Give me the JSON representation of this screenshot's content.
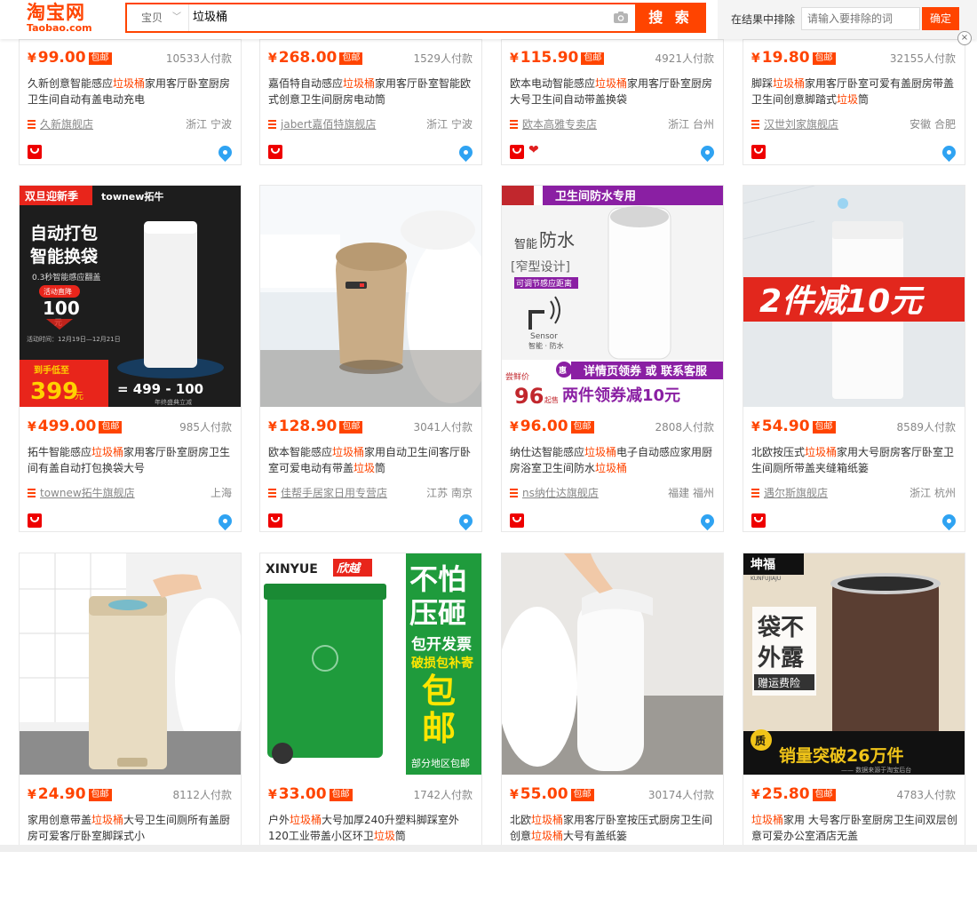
{
  "header": {
    "logo_cn": "淘宝网",
    "logo_en": "Taobao.com",
    "scope": "宝贝",
    "query": "垃圾桶",
    "search_button": "搜 索",
    "exclude_label": "在结果中排除",
    "exclude_placeholder": "请输入要排除的词",
    "exclude_button": "确定",
    "close": "×"
  },
  "badge": "包邮",
  "currency": "¥",
  "row1": [
    {
      "price": "99.00",
      "sales": "10533人付款",
      "title_pre": "久新创意智能感应",
      "hl": "垃圾桶",
      "title_post": "家用客厅卧室厨房卫生间自动有盖电动充电",
      "shop": "久新旗舰店",
      "loc": "浙江 宁波"
    },
    {
      "price": "268.00",
      "sales": "1529人付款",
      "title_pre": "嘉佰特自动感应",
      "hl": "垃圾桶",
      "title_post": "家用客厅卧室智能欧式创意卫生间厨房电动筒",
      "shop": "jabert嘉佰特旗舰店",
      "loc": "浙江 宁波"
    },
    {
      "price": "115.90",
      "sales": "4921人付款",
      "title_pre": "欧本电动智能感应",
      "hl": "垃圾桶",
      "title_post": "家用客厅卧室厨房大号卫生间自动带盖换袋",
      "shop": "欧本高雅专卖店",
      "loc": "浙江 台州"
    },
    {
      "price": "19.80",
      "sales": "32155人付款",
      "title_pre": "脚踩",
      "hl": "垃圾桶",
      "title_post": "家用客厅卧室可爱有盖厨房带盖卫生间创意脚踏式",
      "title_tail": "垃圾",
      "title_end": "筒",
      "shop": "汉世刘家旗舰店",
      "loc": "安徽 合肥"
    }
  ],
  "row2": [
    {
      "price": "499.00",
      "sales": "985人付款",
      "title_pre": "拓牛智能感应",
      "hl": "垃圾桶",
      "title_post": "家用客厅卧室厨房卫生间有盖自动打包换袋大号",
      "shop": "townew拓牛旗舰店",
      "loc": "上海",
      "img": {
        "tag": "双旦迎新季",
        "brand": "townew拓牛",
        "line1": "自动打包",
        "line2": "智能换袋",
        "sub": "0.3秒智能感应翻盖",
        "act": "活动直降",
        "amount": "100",
        "unit": "元",
        "date": "活动时间：12月19日—12月21日",
        "sale": "到手低至",
        "final": "399",
        "final_unit": "元",
        "formula": "= 499 - 100",
        "formula_sub": "年终盛典立减"
      }
    },
    {
      "price": "128.90",
      "sales": "3041人付款",
      "title_pre": "欧本智能感应",
      "hl": "垃圾桶",
      "title_post": "家用自动卫生间客厅卧室可爱电动有带盖",
      "title_tail": "垃圾",
      "title_end": "筒",
      "shop": "佳帮手居家日用专营店",
      "loc": "江苏 南京"
    },
    {
      "price": "96.00",
      "sales": "2808人付款",
      "title_pre": "纳仕达智能感应",
      "hl": "垃圾桶",
      "title_post": "电子自动感应家用厨房浴室卫生间防水",
      "title_tail": "垃圾桶",
      "title_end": "",
      "shop": "ns纳仕达旗舰店",
      "loc": "福建 福州",
      "img": {
        "top": "卫生间防水专用",
        "l1": "智能",
        "l2": "防水",
        "l3": "[窄型设计]",
        "l4": "可调节感应距离",
        "sensor": "Sensor",
        "sensor2": "智能 · 防水",
        "promo": "详情页领券 或 联系客服",
        "hui": "惠",
        "old": "尝鲜价",
        "price": "96",
        "qi": "起售",
        "deal": "两件领券减10元"
      }
    },
    {
      "price": "54.90",
      "sales": "8589人付款",
      "title_pre": "北欧按压式",
      "hl": "垃圾桶",
      "title_post": "家用大号厨房客厅卧室卫生间厕所带盖夹缝箱纸篓",
      "shop": "遇尔斯旗舰店",
      "loc": "浙江 杭州",
      "img": {
        "banner": "2件减10元"
      }
    }
  ],
  "row3": [
    {
      "price": "24.90",
      "sales": "8112人付款",
      "title_pre": "家用创意带盖",
      "hl": "垃圾桶",
      "title_post": "大号卫生间厕所有盖厨房可爱客厅卧室脚踩式小"
    },
    {
      "price": "33.00",
      "sales": "1742人付款",
      "title_pre": "户外",
      "hl": "垃圾桶",
      "title_post": "大号加厚240升塑料脚踩室外120工业带盖小区环卫",
      "title_tail": "垃圾",
      "title_end": "筒",
      "img": {
        "brand": "XINYUE",
        "brand2": "欣越",
        "r1": "不怕",
        "r2": "压砸",
        "r3": "包开发票",
        "r4": "破损包补寄",
        "r5": "包",
        "r6": "邮",
        "r7": "部分地区包邮"
      }
    },
    {
      "price": "55.00",
      "sales": "30174人付款",
      "title_pre": "北欧",
      "hl": "垃圾桶",
      "title_post": "家用客厅卧室按压式厨房卫生间创意",
      "title_tail": "垃圾桶",
      "title_end": "大号有盖纸篓"
    },
    {
      "price": "25.80",
      "sales": "4783人付款",
      "title_pre": "",
      "hl": "垃圾桶",
      "title_post": "家用 大号客厅卧室厨房卫生间双层创意可爱办公室酒店无盖",
      "img": {
        "brand": "坤福",
        "brand_en": "KUNFUJIAJU",
        "c1": "袋不",
        "c2": "外露",
        "c3": "赠运费险",
        "zhi": "质",
        "sold": "销量突破26万件",
        "note": "—— 数据来源于淘宝后台"
      }
    }
  ],
  "colors": {
    "accent": "#ff4400",
    "brand_red": "#e00000"
  }
}
